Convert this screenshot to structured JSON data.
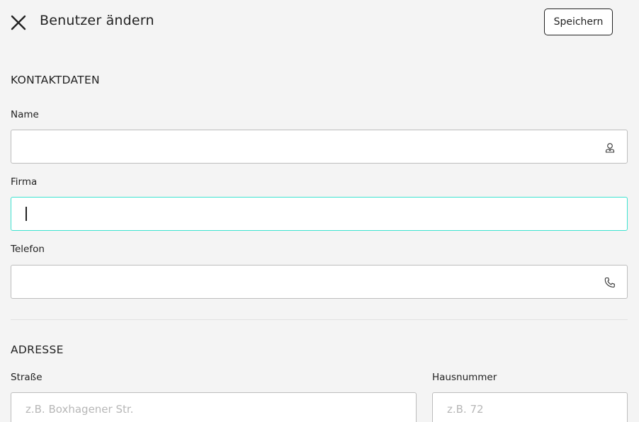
{
  "header": {
    "title": "Benutzer ändern",
    "save_label": "Speichern",
    "close_icon": "close-icon"
  },
  "contact": {
    "section_title": "KONTAKTDATEN",
    "name": {
      "label": "Name",
      "value": "",
      "icon": "person-icon"
    },
    "company": {
      "label": "Firma",
      "value": ""
    },
    "phone": {
      "label": "Telefon",
      "value": "",
      "icon": "phone-icon"
    }
  },
  "address": {
    "section_title": "ADRESSE",
    "street": {
      "label": "Straße",
      "placeholder": "z.B. Boxhagener Str."
    },
    "house_number": {
      "label": "Hausnummer",
      "placeholder": "z.B. 72"
    }
  },
  "colors": {
    "focus_border": "#3ee3d0",
    "background": "#f4f4f4",
    "field_border": "#bdbdbd"
  }
}
